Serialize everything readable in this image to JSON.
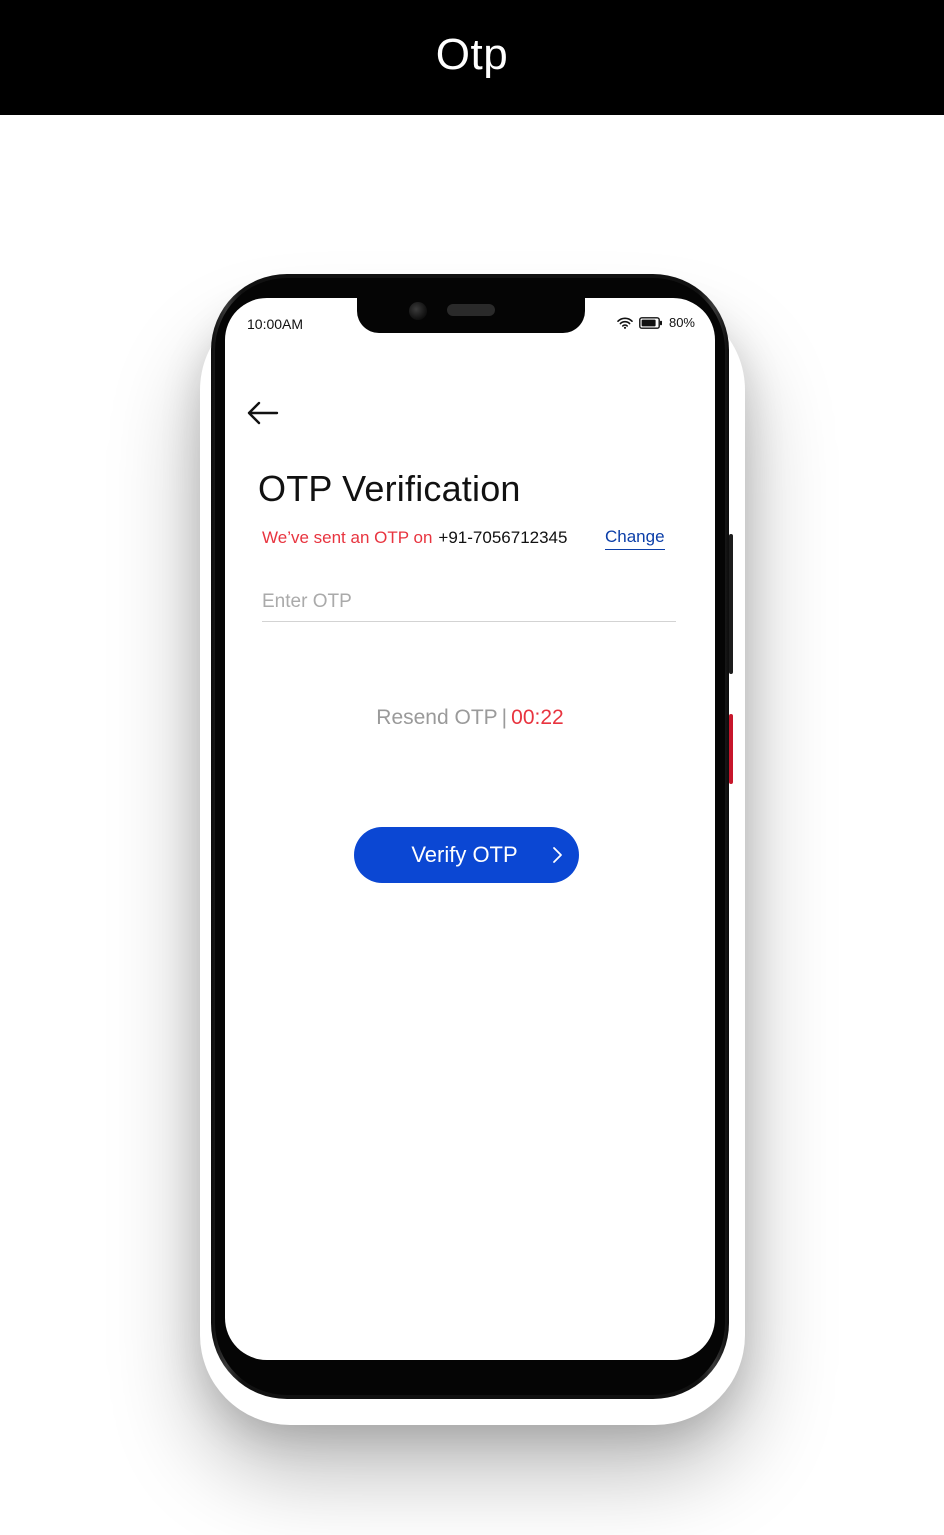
{
  "banner": {
    "title": "Otp"
  },
  "status_bar": {
    "time": "10:00AM",
    "battery": "80%",
    "icons": [
      "wifi-icon",
      "battery-icon"
    ]
  },
  "screen": {
    "back_icon": "arrow-left-icon",
    "title": "OTP Verification",
    "sent_text": "We’ve sent an OTP on",
    "phone_number": "+91-7056712345",
    "change_label": "Change",
    "otp_placeholder": "Enter OTP",
    "otp_value": "",
    "resend_label": "Resend OTP",
    "resend_separator": "|",
    "timer": "00:22",
    "verify_label": "Verify OTP",
    "verify_icon": "chevron-right-icon"
  },
  "colors": {
    "accent_blue": "#0b47d3",
    "link_blue": "#0b3ea8",
    "alert_red": "#e8343f",
    "banner_bg": "#000000"
  }
}
